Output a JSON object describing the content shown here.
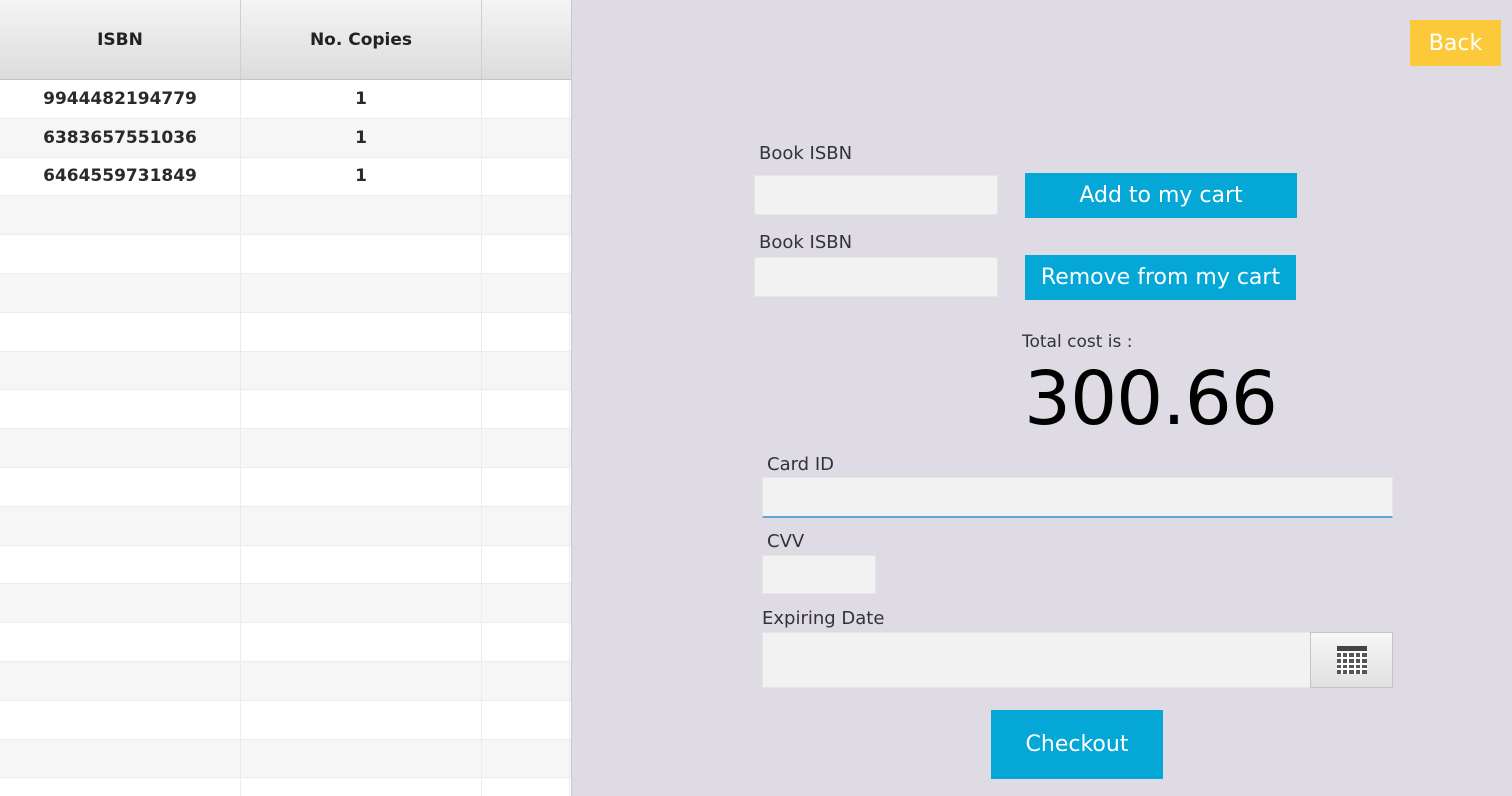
{
  "table": {
    "columns": [
      "ISBN",
      "No. Copies",
      ""
    ],
    "rows": [
      {
        "isbn": "9944482194779",
        "copies": "1"
      },
      {
        "isbn": "6383657551036",
        "copies": "1"
      },
      {
        "isbn": "6464559731849",
        "copies": "1"
      },
      {
        "isbn": "",
        "copies": ""
      },
      {
        "isbn": "",
        "copies": ""
      },
      {
        "isbn": "",
        "copies": ""
      },
      {
        "isbn": "",
        "copies": ""
      },
      {
        "isbn": "",
        "copies": ""
      },
      {
        "isbn": "",
        "copies": ""
      },
      {
        "isbn": "",
        "copies": ""
      },
      {
        "isbn": "",
        "copies": ""
      },
      {
        "isbn": "",
        "copies": ""
      },
      {
        "isbn": "",
        "copies": ""
      },
      {
        "isbn": "",
        "copies": ""
      },
      {
        "isbn": "",
        "copies": ""
      },
      {
        "isbn": "",
        "copies": ""
      },
      {
        "isbn": "",
        "copies": ""
      },
      {
        "isbn": "",
        "copies": ""
      },
      {
        "isbn": "",
        "copies": ""
      }
    ]
  },
  "back_label": "Back",
  "add_form": {
    "label": "Book ISBN",
    "value": "",
    "button_label": "Add to my cart"
  },
  "remove_form": {
    "label": "Book ISBN",
    "value": "",
    "button_label": "Remove from my cart"
  },
  "total": {
    "label": "Total cost is :",
    "value": "300.66"
  },
  "card_id": {
    "label": "Card ID",
    "value": ""
  },
  "cvv": {
    "label": "CVV",
    "value": ""
  },
  "expiry": {
    "label": "Expiring Date",
    "value": "",
    "picker_icon": "calendar-icon"
  },
  "checkout_label": "Checkout",
  "colors": {
    "background": "#dedbe5",
    "accent_blue": "#04a7d5",
    "back_yellow": "#fbc93a",
    "field_bg": "#f2f2f2",
    "focus_border": "#5fa8d6"
  }
}
